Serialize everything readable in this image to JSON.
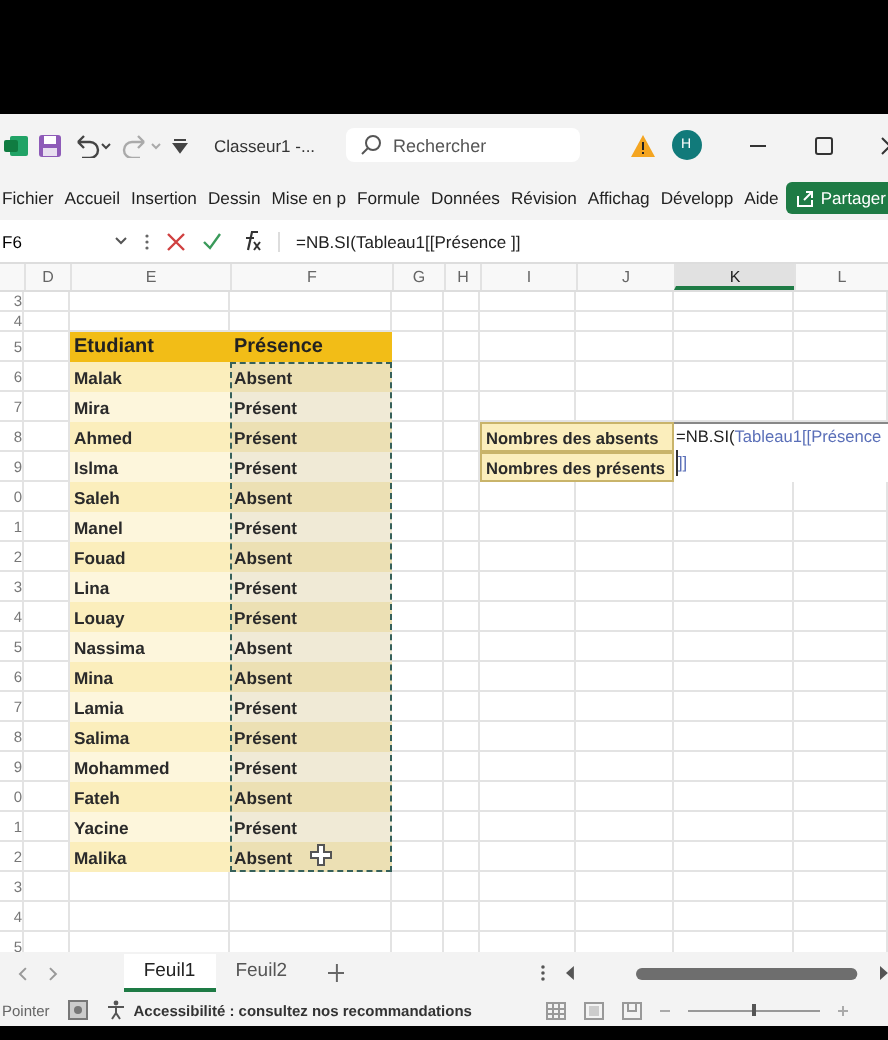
{
  "title_bar": {
    "document": "Classeur1 -...",
    "search": {
      "placeholder": "Rechercher"
    },
    "avatar": "H"
  },
  "ribbon_tabs": [
    {
      "label": "Fichier"
    },
    {
      "label": "Accueil"
    },
    {
      "label": "Insertion"
    },
    {
      "label": "Dessin"
    },
    {
      "label": "Mise en p"
    },
    {
      "label": "Formule"
    },
    {
      "label": "Données"
    },
    {
      "label": "Révision"
    },
    {
      "label": "Affichag"
    },
    {
      "label": "Développ"
    },
    {
      "label": "Aide"
    }
  ],
  "share_button": "Partager",
  "formula_bar": {
    "name_box": "F6",
    "formula": "=NB.SI(Tableau1[[Présence ]]"
  },
  "columns": [
    {
      "label": "D",
      "selected": false
    },
    {
      "label": "E",
      "selected": false
    },
    {
      "label": "F",
      "selected": false
    },
    {
      "label": "G",
      "selected": false
    },
    {
      "label": "H",
      "selected": false
    },
    {
      "label": "I",
      "selected": false
    },
    {
      "label": "J",
      "selected": false
    },
    {
      "label": "K",
      "selected": true
    },
    {
      "label": "L",
      "selected": false
    }
  ],
  "row_numbers": [
    "3",
    "4",
    "5",
    "6",
    "7",
    "8",
    "9",
    "0",
    "1",
    "2",
    "3",
    "4",
    "5",
    "6",
    "7",
    "8",
    "9",
    "0",
    "1",
    "2",
    "3",
    "4",
    "5"
  ],
  "table": {
    "headers": [
      "Etudiant",
      "Présence"
    ],
    "copy_marquee": true,
    "rows": [
      {
        "name": "Malak",
        "presence": "Absent"
      },
      {
        "name": "Mira",
        "presence": "Présent"
      },
      {
        "name": "Ahmed",
        "presence": "Présent"
      },
      {
        "name": "Islma",
        "presence": "Présent"
      },
      {
        "name": "Saleh",
        "presence": "Absent"
      },
      {
        "name": "Manel",
        "presence": "Présent"
      },
      {
        "name": "Fouad",
        "presence": "Absent"
      },
      {
        "name": "Lina",
        "presence": "Présent"
      },
      {
        "name": "Louay",
        "presence": "Présent"
      },
      {
        "name": "Nassima",
        "presence": "Absent"
      },
      {
        "name": "Mina",
        "presence": "Absent"
      },
      {
        "name": "Lamia",
        "presence": "Présent"
      },
      {
        "name": "Salima",
        "presence": "Présent"
      },
      {
        "name": "Mohammed",
        "presence": "Présent"
      },
      {
        "name": "Fateh",
        "presence": "Absent"
      },
      {
        "name": "Yacine",
        "presence": "Présent"
      },
      {
        "name": "Malika",
        "presence": "Absent"
      }
    ]
  },
  "summary": [
    "Nombres des absents",
    "Nombres des présents"
  ],
  "editing_cell": {
    "formula_name": "=NB.SI(",
    "formula_ref": "Tableau1[[Présence",
    "continuation": "]]"
  },
  "sheet_tabs": [
    {
      "label": "Feuil1",
      "selected": true
    },
    {
      "label": "Feuil2",
      "selected": false
    }
  ],
  "status_bar": {
    "mode": "Pointer",
    "accessibility": "Accessibilité : consultez nos recommandations",
    "zoom": {
      "level": 0.5
    }
  }
}
